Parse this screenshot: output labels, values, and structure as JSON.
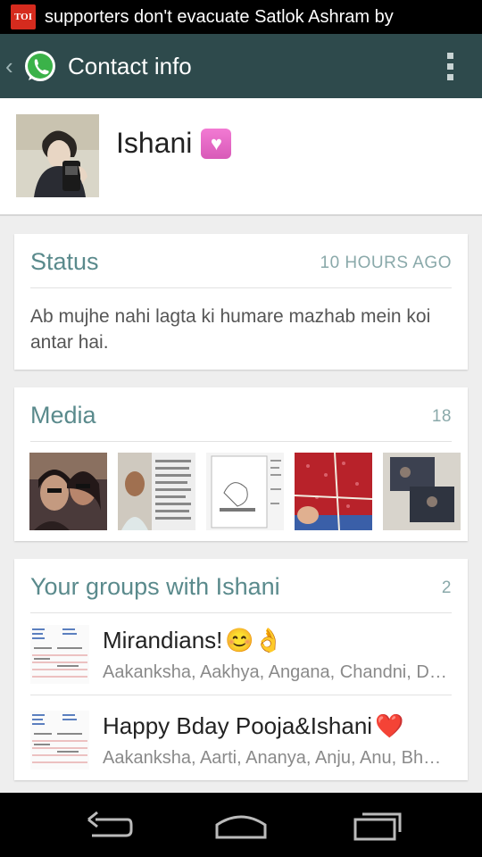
{
  "statusbar": {
    "app_icon_text": "TOI",
    "ticker": "supporters don't evacuate Satlok Ashram by"
  },
  "actionbar": {
    "title": "Contact info"
  },
  "profile": {
    "name": "Ishani",
    "name_emoji": "heart-decoration-icon"
  },
  "status": {
    "heading": "Status",
    "time": "10 HOURS AGO",
    "text": "Ab mujhe nahi lagta ki humare mazhab mein koi antar hai."
  },
  "media": {
    "heading": "Media",
    "count": "18"
  },
  "groups": {
    "heading": "Your groups with Ishani",
    "count": "2",
    "items": [
      {
        "name": "Mirandians!",
        "emoji": "😊👌",
        "members": "Aakanksha, Aakhya, Angana, Chandni, Devika"
      },
      {
        "name": "Happy Bday Pooja&Ishani",
        "emoji": "❤️",
        "members": "Aakanksha, Aarti, Ananya, Anju, Anu, Bhavna"
      }
    ]
  },
  "colors": {
    "actionbar": "#2e4a4c",
    "accent_text": "#5a8a8c",
    "background": "#eeeeee"
  }
}
